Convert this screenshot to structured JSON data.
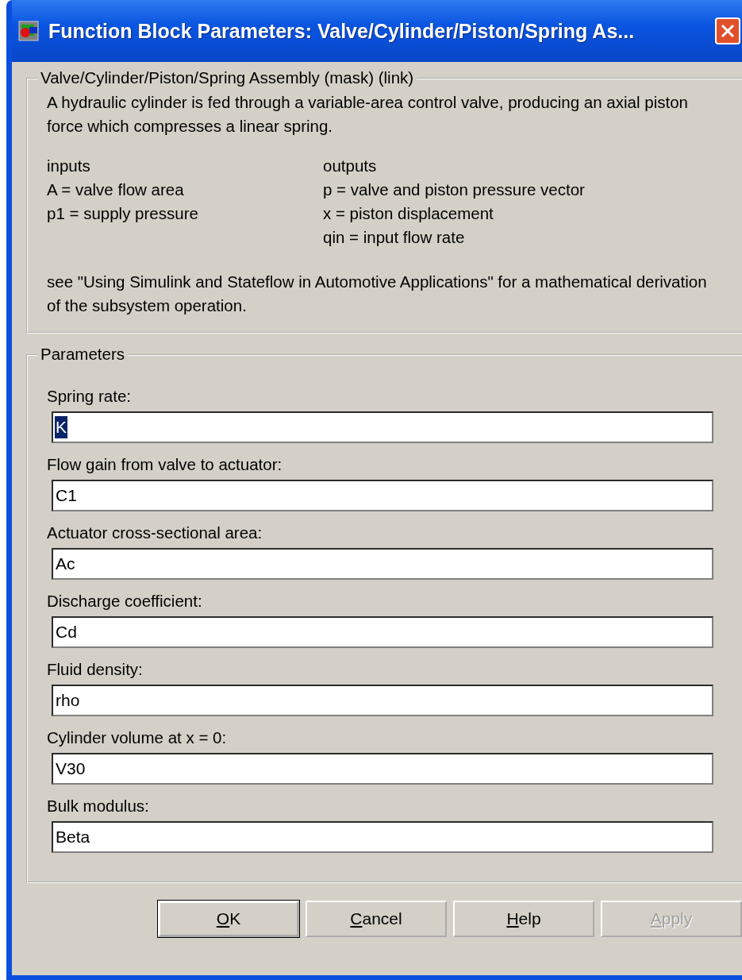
{
  "window": {
    "title": "Function Block Parameters: Valve/Cylinder/Piston/Spring As..."
  },
  "description": {
    "title": "Valve/Cylinder/Piston/Spring Assembly (mask) (link)",
    "summary": "A hydraulic cylinder is fed through a variable-area control valve, producing an axial piston force which compresses a linear spring.",
    "inputs": [
      "inputs",
      "A = valve flow area",
      "p1 = supply pressure"
    ],
    "outputs": [
      "outputs",
      "p = valve and piston pressure vector",
      "x = piston displacement",
      "qin = input flow rate"
    ],
    "note": "see \"Using Simulink and Stateflow in Automotive Applications\" for a mathematical derivation of the subsystem operation."
  },
  "parameters": {
    "title": "Parameters",
    "fields": [
      {
        "label": "Spring rate:",
        "value": "K",
        "selected": true
      },
      {
        "label": "Flow gain from valve to actuator:",
        "value": "C1",
        "selected": false
      },
      {
        "label": "Actuator cross-sectional area:",
        "value": "Ac",
        "selected": false
      },
      {
        "label": "Discharge coefficient:",
        "value": "Cd",
        "selected": false
      },
      {
        "label": "Fluid density:",
        "value": "rho",
        "selected": false
      },
      {
        "label": "Cylinder volume at x = 0:",
        "value": "V30",
        "selected": false
      },
      {
        "label": "Bulk modulus:",
        "value": "Beta",
        "selected": false
      }
    ]
  },
  "buttons": [
    {
      "label": "OK",
      "default": true,
      "disabled": false
    },
    {
      "label": "Cancel",
      "default": false,
      "disabled": false
    },
    {
      "label": "Help",
      "default": false,
      "disabled": false
    },
    {
      "label": "Apply",
      "default": false,
      "disabled": true
    }
  ]
}
